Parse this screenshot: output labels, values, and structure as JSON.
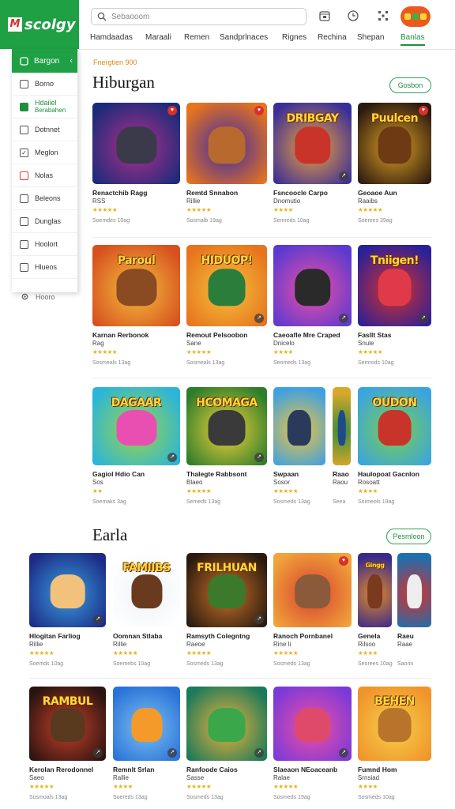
{
  "app": {
    "logo_mark": "M",
    "logo_text": "scolgy"
  },
  "search": {
    "placeholder": "Sebaooom"
  },
  "header": {
    "icons": [
      "calendar-icon",
      "clock-icon",
      "grid-icon"
    ],
    "avatar_colors": [
      "#f6d33b",
      "#3bb34a",
      "#f6d33b"
    ]
  },
  "nav": {
    "tabs": [
      {
        "label": "Hamdaadas",
        "active": false
      },
      {
        "label": "Maraali",
        "active": false
      },
      {
        "label": "Remen",
        "active": false
      },
      {
        "label": "Sandprlnaces",
        "active": false
      },
      {
        "label": "Rignes",
        "active": false
      },
      {
        "label": "Rechina",
        "active": false
      },
      {
        "label": "Shepan",
        "active": false
      },
      {
        "label": "Banlas",
        "active": true
      }
    ]
  },
  "sidebar": {
    "header": "Bargon",
    "items": [
      {
        "label": "Borno",
        "icon": "square-icon",
        "style": ""
      },
      {
        "label": "Hdaiiel",
        "label2": "Berabahen",
        "icon": "square-icon",
        "style": "green"
      },
      {
        "label": "Dotnnet",
        "icon": "square-icon",
        "style": ""
      },
      {
        "label": "Meglon",
        "icon": "check-icon",
        "style": ""
      },
      {
        "label": "Nolas",
        "icon": "square-icon",
        "style": "red"
      },
      {
        "label": "Beleons",
        "icon": "square-icon",
        "style": ""
      },
      {
        "label": "Dunglas",
        "icon": "square-icon",
        "style": ""
      },
      {
        "label": "Hoolort",
        "icon": "square-icon",
        "style": ""
      },
      {
        "label": "Hlueos",
        "icon": "square-icon",
        "style": ""
      }
    ],
    "extra": {
      "label": "Hooro",
      "icon": "settings-icon"
    }
  },
  "section1": {
    "eyebrow": "Fnergtien 900",
    "title": "Hiburgan",
    "action": "Gosbon"
  },
  "section2": {
    "title": "Earla",
    "action": "Pesmloon"
  },
  "grid1": [
    {
      "title": "Renactchib Ragg",
      "sub": "RSS",
      "rating": 5,
      "meta": "Soemdes 10ag",
      "word": "",
      "bg": [
        "#1b2b7a",
        "#b22f8a"
      ],
      "accent": "#3a3a4a",
      "badge": "tr"
    },
    {
      "title": "Remtd Snnabon",
      "sub": "Rillie",
      "rating": 5,
      "meta": "Sosmalb 19ag",
      "word": "",
      "bg": [
        "#e7741d",
        "#3a2aa8"
      ],
      "accent": "#b86a2e",
      "badge": "tr"
    },
    {
      "title": "Fsncoocle Carpo",
      "sub": "Dnomutio",
      "rating": 4,
      "meta": "Semreds 10ag",
      "word": "DRIBGAY",
      "bg": [
        "#3a2f98",
        "#f2a23a"
      ],
      "accent": "#c8342a",
      "badge": "br"
    },
    {
      "title": "Geoaoe Aun",
      "sub": "Raaibs",
      "rating": 5,
      "meta": "Soerees 39ag",
      "word": "Puulcen",
      "bg": [
        "#2b1a10",
        "#e0a124"
      ],
      "accent": "#6e3a14",
      "badge": "tr"
    },
    {
      "title": "Karnan Rerbonok",
      "sub": "Rag",
      "rating": 5,
      "meta": "Sosmeals 13ag",
      "word": "Paroul",
      "bg": [
        "#d7501f",
        "#f3c03c"
      ],
      "accent": "#8a4a22",
      "badge": ""
    },
    {
      "title": "Remout Pelsoobon",
      "sub": "Sane",
      "rating": 5,
      "meta": "Sosmeals 13ag",
      "word": "HIDUOP!",
      "bg": [
        "#e7731c",
        "#f4c23d"
      ],
      "accent": "#2a7d3a",
      "badge": "br"
    },
    {
      "title": "Caeoafle Mre Craped",
      "sub": "Dnicelo",
      "rating": 4,
      "meta": "Seomeds 13ag",
      "word": "",
      "bg": [
        "#5a3ad1",
        "#f04fa4"
      ],
      "accent": "#2a2a2a",
      "badge": "br"
    },
    {
      "title": "Fasllt Stas",
      "sub": "Snule",
      "rating": 5,
      "meta": "Semrods 10ag",
      "word": "Tniigen!",
      "bg": [
        "#2a2198",
        "#d7302a"
      ],
      "accent": "#e03a4a",
      "badge": "br"
    },
    {
      "title": "Gagiol Hdio Can",
      "sub": "Sos",
      "rating": 2,
      "meta": "Soemaks 3ag",
      "word": "DAGAAR",
      "bg": [
        "#2ab5d9",
        "#9dd448"
      ],
      "accent": "#e94fb0",
      "badge": "br"
    },
    {
      "title": "Thalegte Rabbsont",
      "sub": "Blaeo",
      "rating": 5,
      "meta": "Semeds 13ag",
      "word": "HCOMAGA",
      "bg": [
        "#2e7d2a",
        "#f1d23b"
      ],
      "accent": "#3a3a3a",
      "badge": "br"
    },
    {
      "title": "Swpaan",
      "sub": "Sosor",
      "rating": 5,
      "meta": "Sosmeds 13ag",
      "word": "",
      "bg": [
        "#3fa0e3",
        "#f0c53a"
      ],
      "accent": "#2a3a5a",
      "badge": ""
    },
    {
      "title": "Raao",
      "sub": "Raou",
      "rating": 0,
      "meta": "Seea",
      "word": "",
      "bg": [
        "#d8a82a",
        "#3a8a3a"
      ],
      "accent": "#1e4a8a",
      "badge": ""
    },
    {
      "title": "Haulopoat Gacnlon",
      "sub": "Rosoatt",
      "rating": 4,
      "meta": "Soimeols 19ag",
      "word": "OUDON",
      "bg": [
        "#3aa4e0",
        "#7ccf4a"
      ],
      "accent": "#c8342a",
      "badge": ""
    }
  ],
  "grid2": [
    {
      "title": "Hlogitan Farliog",
      "sub": "Rillie",
      "rating": 5,
      "meta": "Soemds 10ag",
      "word": "",
      "bg": [
        "#1c2c86",
        "#3a9ee0"
      ],
      "accent": "#f2c27d",
      "badge": "br"
    },
    {
      "title": "Oomnan Stlaba",
      "sub": "Rillie",
      "rating": 5,
      "meta": "Soemebs 10ag",
      "word": "FAMIIBS",
      "bg": [
        "#ffffff",
        "#eef3f7"
      ],
      "accent": "#6a3a1e",
      "badge": ""
    },
    {
      "title": "Ramsyth Colegntng",
      "sub": "Raeoe",
      "rating": 5,
      "meta": "Sosmeds 13ag",
      "word": "FRILHUAN",
      "bg": [
        "#2a1a0e",
        "#c8722a"
      ],
      "accent": "#3a7a2a",
      "badge": "br"
    },
    {
      "title": "Ranoch Pornbanel",
      "sub": "Rine li",
      "rating": 5,
      "meta": "Sosmeds 13ag",
      "word": "",
      "bg": [
        "#f0a43a",
        "#d8402e"
      ],
      "accent": "#8a5a3a",
      "badge": "tr"
    },
    {
      "title": "Genela",
      "sub": "Rilsoo",
      "rating": 4,
      "meta": "Seorees 10ag",
      "word": "Gingg",
      "bg": [
        "#3a2a8a",
        "#e08a2a"
      ],
      "accent": "#7a3a1e",
      "badge": ""
    },
    {
      "title": "Raeu",
      "sub": "Raae",
      "rating": 0,
      "meta": "Saorin",
      "word": "",
      "bg": [
        "#1d6fb0",
        "#d8302a"
      ],
      "accent": "#eeeeee",
      "badge": ""
    },
    {
      "title": "Kerolan Rerodonnel",
      "sub": "Saeo",
      "rating": 5,
      "meta": "Sosmoals 13ag",
      "word": "RAMBUL",
      "bg": [
        "#2a1410",
        "#c8402a"
      ],
      "accent": "#5a3a1e",
      "badge": "br"
    },
    {
      "title": "Remnlt Srlan",
      "sub": "Rallie",
      "rating": 4,
      "meta": "Soereds 13ag",
      "word": "",
      "bg": [
        "#2a72d8",
        "#7ac0f0"
      ],
      "accent": "#f39a2a",
      "badge": "br"
    },
    {
      "title": "Ranfoode Caios",
      "sub": "Sasse",
      "rating": 5,
      "meta": "Sosmeds 13ag",
      "word": "",
      "bg": [
        "#1a7a5a",
        "#f0b23a"
      ],
      "accent": "#3aa84a",
      "badge": "br"
    },
    {
      "title": "Slaeaon NEoaceanb",
      "sub": "Ralae",
      "rating": 5,
      "meta": "Sosmeds 19ag",
      "word": "",
      "bg": [
        "#7a3ad8",
        "#f04fa4"
      ],
      "accent": "#e04a6a",
      "badge": "br"
    },
    {
      "title": "Fumnd Hom",
      "sub": "Srnsiad",
      "rating": 4,
      "meta": "Sosmeds 10ag",
      "word": "BEHEN",
      "bg": [
        "#f0932a",
        "#f6d04a"
      ],
      "accent": "#b8742a",
      "badge": ""
    }
  ]
}
